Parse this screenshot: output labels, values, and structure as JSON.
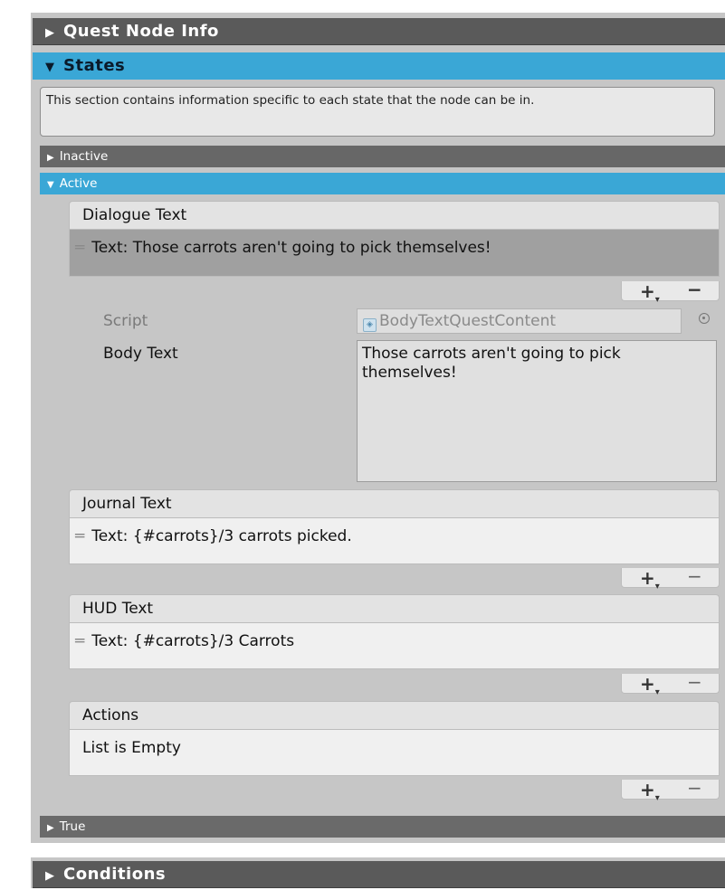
{
  "sections": {
    "quest_node_info": "Quest Node Info",
    "states": "States",
    "conditions": "Conditions"
  },
  "states_help": "This section contains information specific to each state that the node can be in.",
  "state_headers": {
    "inactive": "Inactive",
    "active": "Active",
    "true": "True"
  },
  "arrows": {
    "collapsed": "▶",
    "expanded": "▼"
  },
  "dialogue": {
    "header": "Dialogue Text",
    "item": "Text: Those carrots aren't going to pick themselves!"
  },
  "content_fields": {
    "script_label": "Script",
    "script_value": "BodyTextQuestContent",
    "body_text_label": "Body Text",
    "body_text_value": "Those carrots aren't going to pick themselves!"
  },
  "journal": {
    "header": "Journal Text",
    "item": "Text: {#carrots}/3 carrots picked."
  },
  "hud": {
    "header": "HUD Text",
    "item": "Text: {#carrots}/3 Carrots"
  },
  "actions": {
    "header": "Actions",
    "empty": "List is Empty"
  },
  "list_controls": {
    "add": "+",
    "remove": "−"
  },
  "colors": {
    "header_dark": "#5a5a5a",
    "header_selected": "#3aa7d6",
    "panel_bg": "#c6c6c6"
  }
}
